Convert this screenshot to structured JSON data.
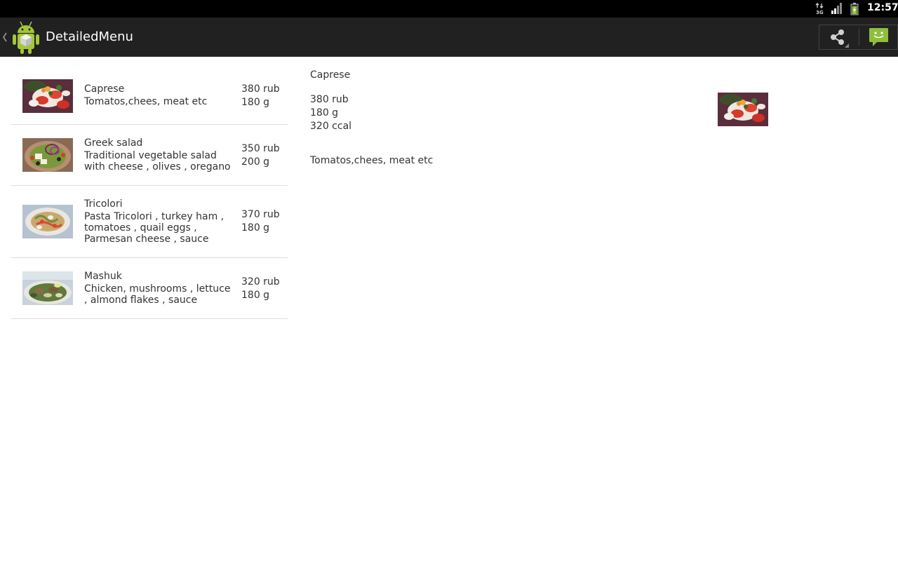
{
  "status_bar": {
    "time": "12:57",
    "network_icon": "3g-data-icon",
    "signal_icon": "signal-strength-icon",
    "battery_icon": "battery-charging-icon"
  },
  "action_bar": {
    "title": "DetailedMenu",
    "up_icon": "chevron-left-icon",
    "logo_icon": "android-robot-logo",
    "share_icon": "share-icon",
    "chat_icon": "chat-bubble-icon"
  },
  "menu": {
    "items": [
      {
        "name": "Caprese",
        "description": "Tomatos,chees, meat etc",
        "price": "380 rub",
        "weight": "180 g",
        "image": "caprese-salad-photo"
      },
      {
        "name": "Greek salad",
        "description": "Traditional vegetable salad with cheese , olives , oregano",
        "price": "350 rub",
        "weight": "200 g",
        "image": "greek-salad-photo"
      },
      {
        "name": "Tricolori",
        "description": "Pasta Tricolori , turkey ham , tomatoes , quail eggs , Parmesan cheese , sauce",
        "price": "370 rub",
        "weight": "180 g",
        "image": "tricolori-pasta-photo"
      },
      {
        "name": "Mashuk",
        "description": "Chicken, mushrooms , lettuce , almond flakes , sauce",
        "price": "320 rub",
        "weight": "180 g",
        "image": "mashuk-salad-photo"
      }
    ]
  },
  "detail": {
    "name": "Caprese",
    "price": "380 rub",
    "weight": "180 g",
    "calories": "320 ccal",
    "description": "Tomatos,chees, meat etc",
    "image": "caprese-salad-photo"
  },
  "colors": {
    "status_bar": "#000000",
    "action_bar": "#212121",
    "divider": "#dddddd",
    "text": "#333333",
    "accent_green": "#8fbf3a"
  }
}
